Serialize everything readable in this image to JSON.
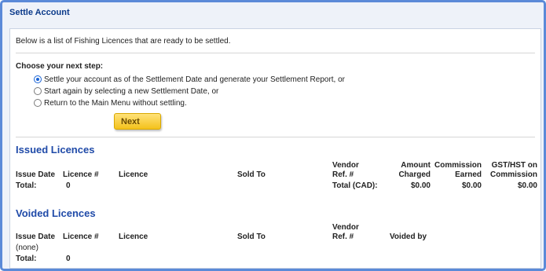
{
  "window": {
    "title": "Settle Account"
  },
  "intro_text": "Below is a list of Fishing Licences that are ready to be settled.",
  "next_step": {
    "heading": "Choose your next step:",
    "options": [
      {
        "label": "Settle your account as of the Settlement Date and generate your Settlement Report, or",
        "selected": true
      },
      {
        "label": "Start again by selecting a new Settlement Date, or",
        "selected": false
      },
      {
        "label": "Return to the Main Menu without settling.",
        "selected": false
      }
    ],
    "button_label": "Next"
  },
  "issued": {
    "title": "Issued Licences",
    "headers": {
      "issue_date": "Issue Date",
      "licence_no": "Licence #",
      "licence": "Licence",
      "sold_to": "Sold To",
      "vendor_ref_1": "Vendor",
      "vendor_ref_2": "Ref. #",
      "amount_1": "Amount",
      "amount_2": "Charged",
      "commission_1": "Commission",
      "commission_2": "Earned",
      "gst_1": "GST/HST on",
      "gst_2": "Commission"
    },
    "total_label": "Total:",
    "total_count": "0",
    "total_cad_label": "Total (CAD):",
    "amount_charged": "$0.00",
    "commission_earned": "$0.00",
    "gst_on_commission": "$0.00"
  },
  "voided": {
    "title": "Voided Licences",
    "headers": {
      "issue_date": "Issue Date",
      "licence_no": "Licence #",
      "licence": "Licence",
      "sold_to": "Sold To",
      "vendor_ref_1": "Vendor",
      "vendor_ref_2": "Ref. #",
      "voided_by": "Voided by"
    },
    "empty_text": "(none)",
    "total_label": "Total:",
    "total_count": "0"
  },
  "colors": {
    "title_blue": "#0b3a8a",
    "section_blue": "#1f4aa8",
    "frame_blue": "#5b8ad8",
    "button_yellow": "#f4c21c"
  }
}
